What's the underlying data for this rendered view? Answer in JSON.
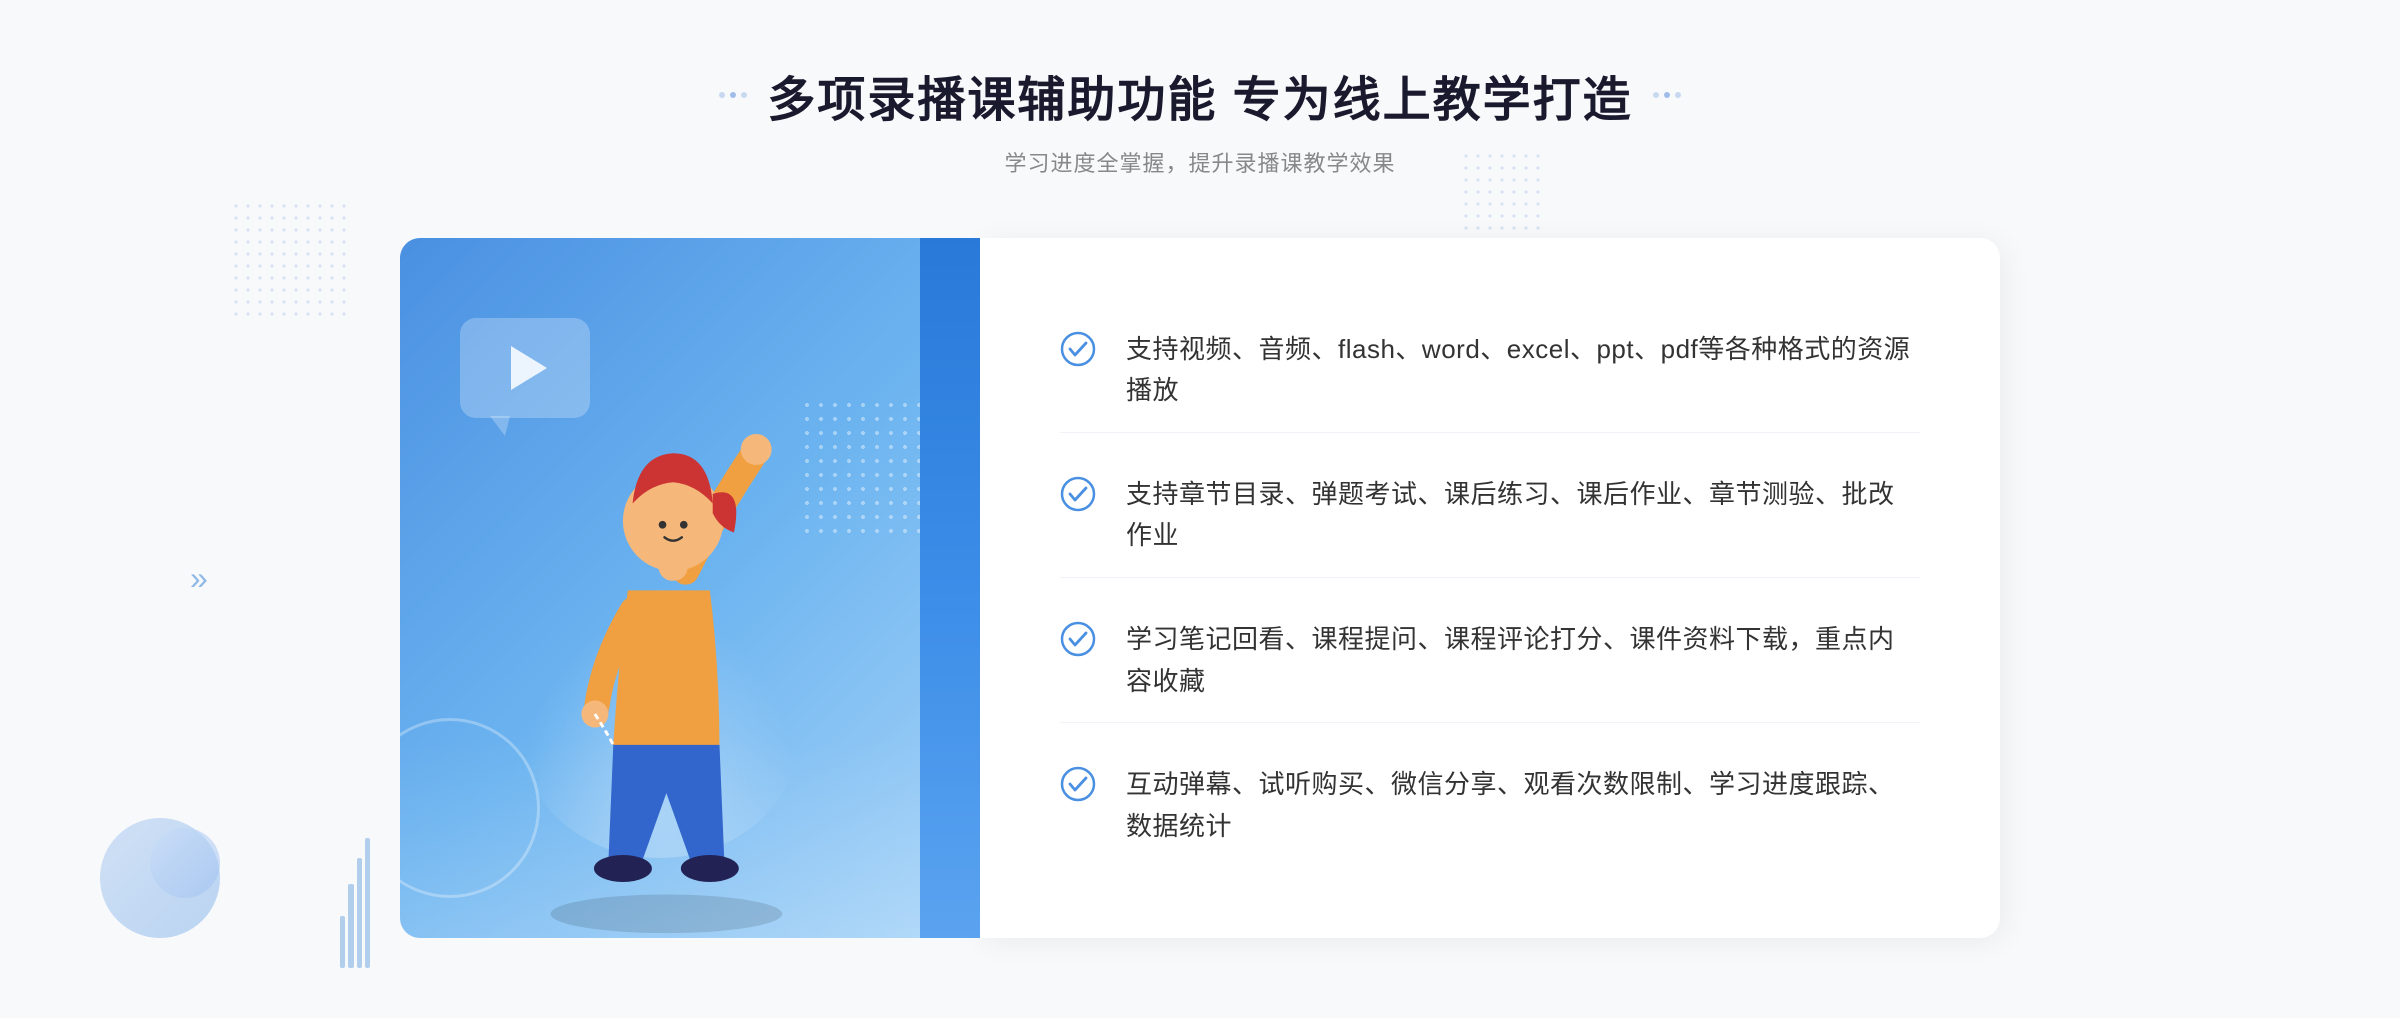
{
  "page": {
    "background": "#f8f9fb"
  },
  "header": {
    "title": "多项录播课辅助功能 专为线上教学打造",
    "subtitle": "学习进度全掌握，提升录播课教学效果"
  },
  "features": [
    {
      "id": "feature-1",
      "text": "支持视频、音频、flash、word、excel、ppt、pdf等各种格式的资源播放",
      "check_icon": "check-circle-icon"
    },
    {
      "id": "feature-2",
      "text": "支持章节目录、弹题考试、课后练习、课后作业、章节测验、批改作业",
      "check_icon": "check-circle-icon"
    },
    {
      "id": "feature-3",
      "text": "学习笔记回看、课程提问、课程评论打分、课件资料下载，重点内容收藏",
      "check_icon": "check-circle-icon"
    },
    {
      "id": "feature-4",
      "text": "互动弹幕、试听购买、微信分享、观看次数限制、学习进度跟踪、数据统计",
      "check_icon": "check-circle-icon"
    }
  ],
  "icons": {
    "check_color": "#4a90e2",
    "arrow_left": "»",
    "play": "▶"
  }
}
